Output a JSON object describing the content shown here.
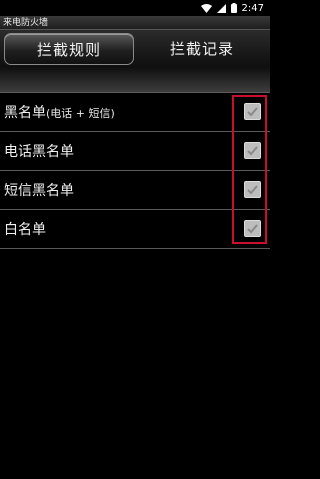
{
  "status_bar": {
    "time": "2:47"
  },
  "window": {
    "title": "来电防火墙"
  },
  "tabs": [
    {
      "label": "拦截规则"
    },
    {
      "label": "拦截记录"
    }
  ],
  "rules": [
    {
      "label": "黑名单",
      "sub": "(电话 + 短信)",
      "checked": true
    },
    {
      "label": "电话黑名单",
      "sub": "",
      "checked": true
    },
    {
      "label": "短信黑名单",
      "sub": "",
      "checked": true
    },
    {
      "label": "白名单",
      "sub": "",
      "checked": true
    }
  ],
  "colors": {
    "highlight": "#c8102e",
    "checkbox": "#bdbdbd"
  }
}
